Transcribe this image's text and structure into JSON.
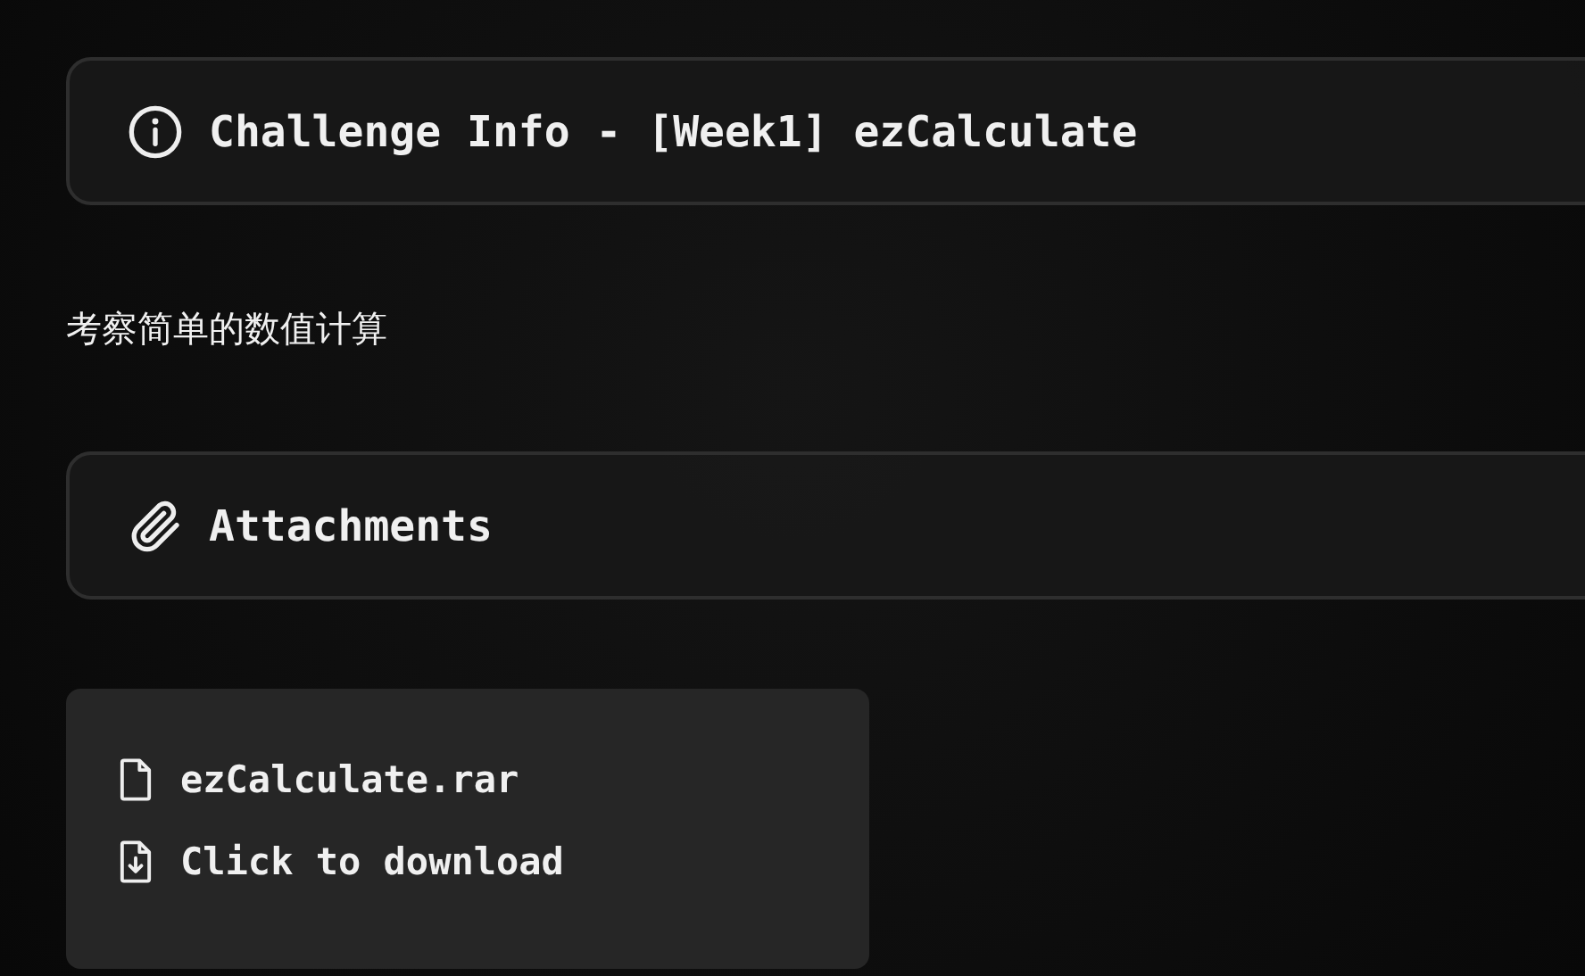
{
  "challenge_info": {
    "title": "Challenge Info - [Week1] ezCalculate"
  },
  "description": "考察简单的数值计算",
  "attachments": {
    "title": "Attachments"
  },
  "files": [
    {
      "kind": "file",
      "label": "ezCalculate.rar"
    },
    {
      "kind": "download",
      "label": "Click to download"
    }
  ]
}
